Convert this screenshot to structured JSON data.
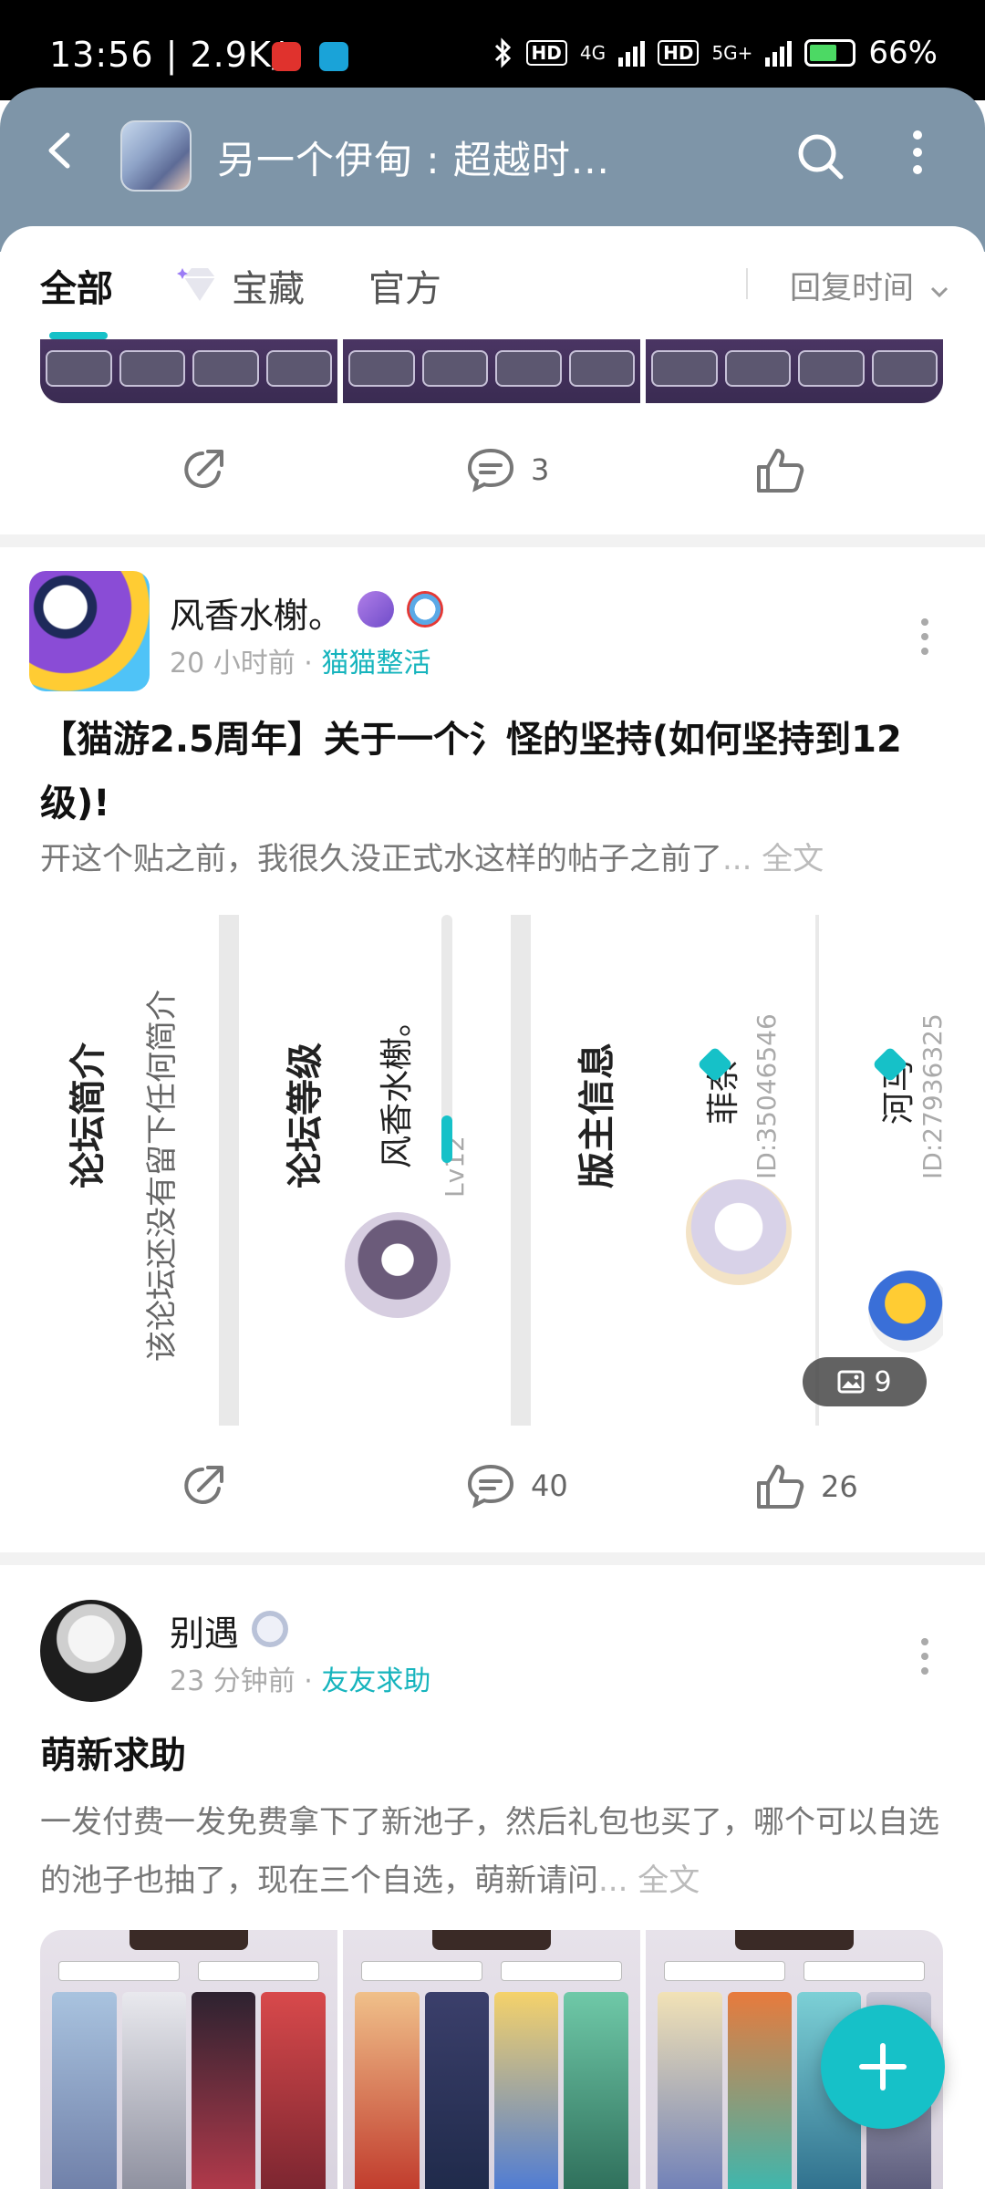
{
  "status_bar": {
    "time": "13:56 | 2.9K/s",
    "signal1": "4G",
    "signal2": "5G+",
    "battery": "66%",
    "hd": "HD"
  },
  "header": {
    "title": "另一个伊甸 : 超越时...",
    "icons": [
      "back-icon",
      "search-icon",
      "more-icon"
    ]
  },
  "tabs": {
    "items": [
      "全部",
      "宝藏",
      "官方"
    ],
    "active": "全部",
    "sort_label": "回复时间"
  },
  "post0": {
    "comments": "3"
  },
  "post1": {
    "username": "风香水榭。",
    "time": "20 小时前",
    "category": "猫猫整活",
    "title": "【猫游2.5周年】关于一个氵怪的坚持(如何坚持到12级)!",
    "excerpt": "开这个贴之前，我很久没正式水这样的帖子之前了",
    "more": "... 全文",
    "forum_shot": {
      "intro_title": "论坛简介",
      "intro_text": "该论坛还没有留下任何简介",
      "level_title": "论坛等级",
      "level_user": "风香水榭。",
      "level": "Lv12",
      "mod_title": "版主信息",
      "mod1_name": "菲奈",
      "mod1_id": "ID:35046546",
      "mod2_name": "河马",
      "mod2_id": "ID:27936325"
    },
    "image_count": "9",
    "comments": "40",
    "likes": "26"
  },
  "post2": {
    "username": "别遇",
    "time": "23 分钟前",
    "category": "友友求助",
    "title": "萌新求助",
    "excerpt": "一发付费一发免费拿下了新池子，然后礼包也买了，哪个可以自选的池子也抽了，现在三个自选，萌新请问",
    "more": "... 全文"
  },
  "colors": {
    "accent": "#16c1c8",
    "header_bg": "#7e95a8"
  }
}
